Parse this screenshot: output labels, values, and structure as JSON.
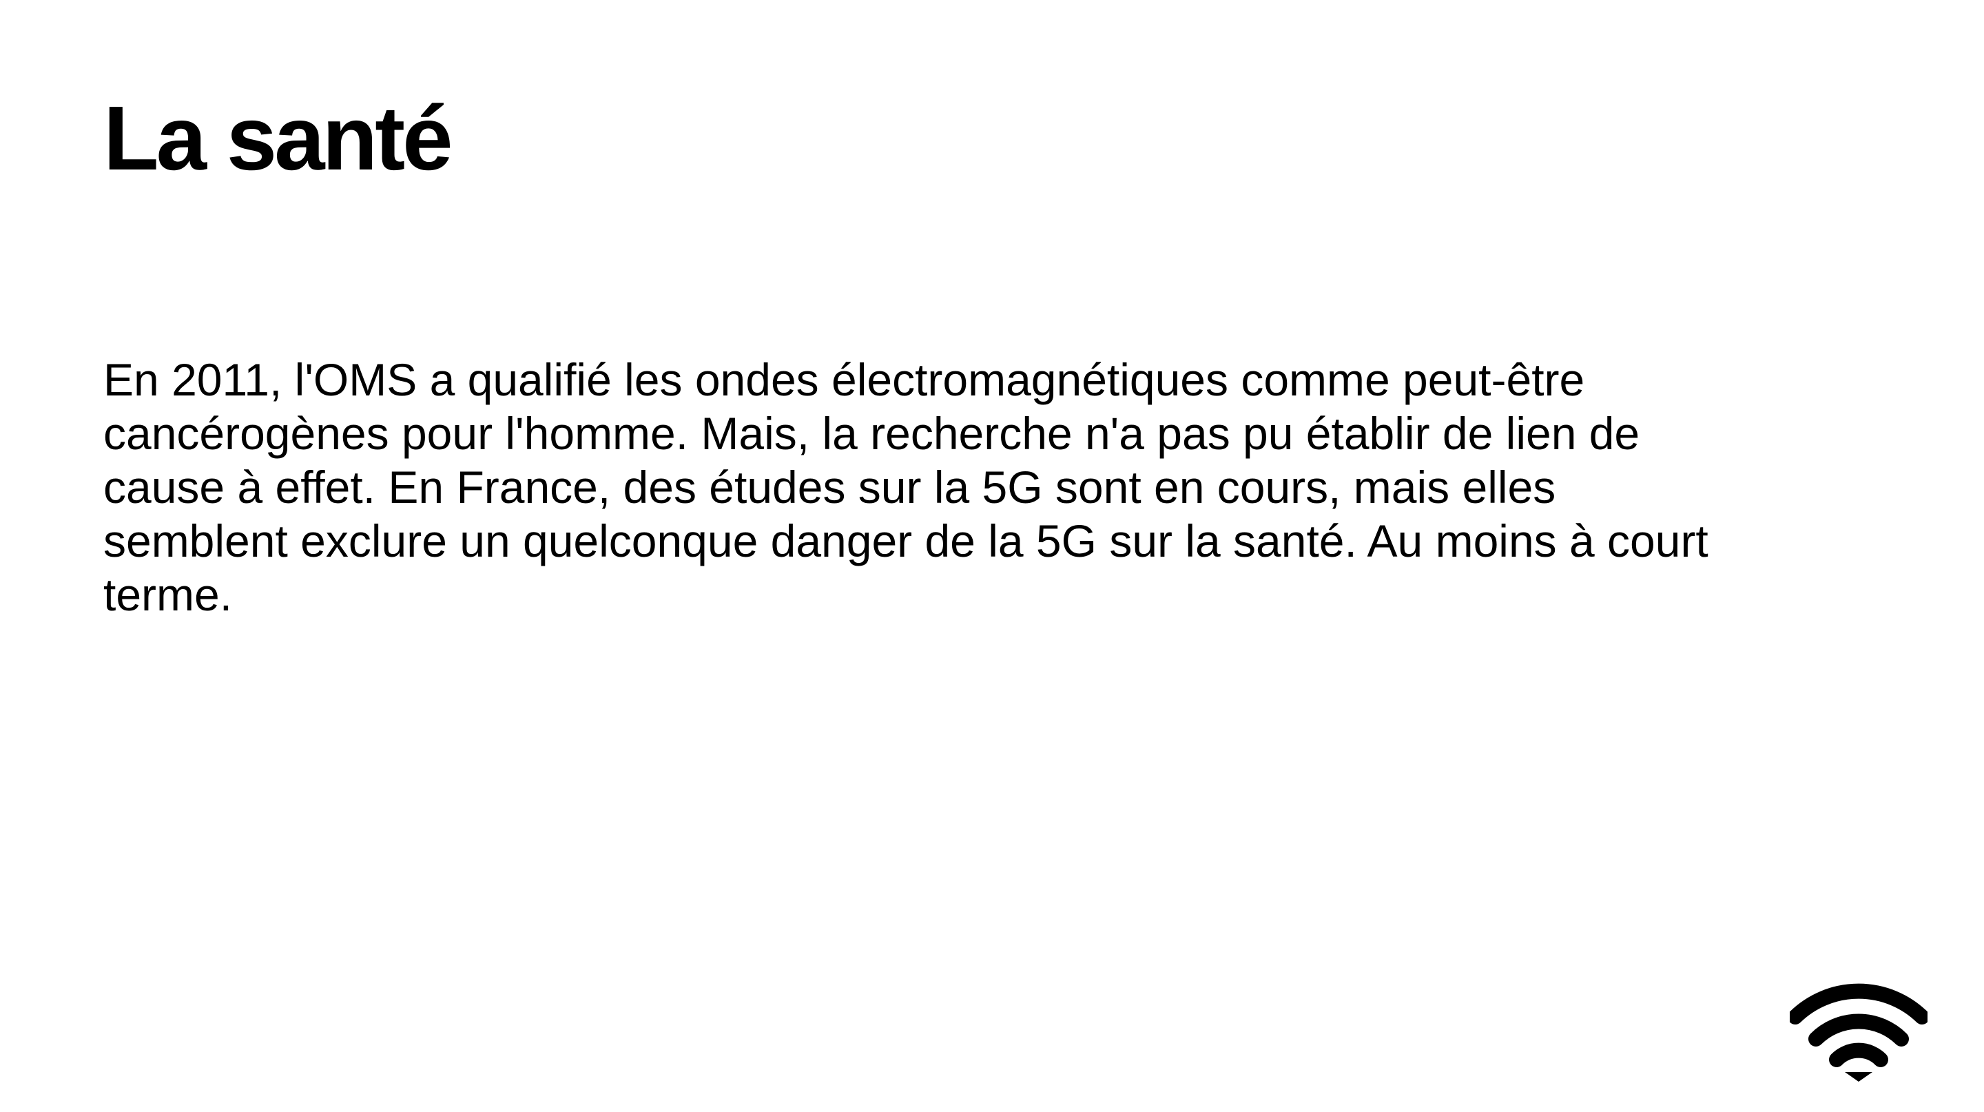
{
  "slide": {
    "title": "La santé",
    "body_lines": [
      "En 2011, l'OMS a qualifié les ondes électromagnétiques comme peut-être",
      "cancérogènes pour l'homme. Mais, la recherche n'a pas pu établir de lien de",
      "cause à effet. En France, des études sur la 5G sont en cours, mais elles",
      "semblent exclure un quelconque danger de la 5G sur la santé. Au moins à court",
      "terme."
    ],
    "icon": "wifi-icon",
    "colors": {
      "background": "#ffffff",
      "text": "#000000"
    }
  }
}
